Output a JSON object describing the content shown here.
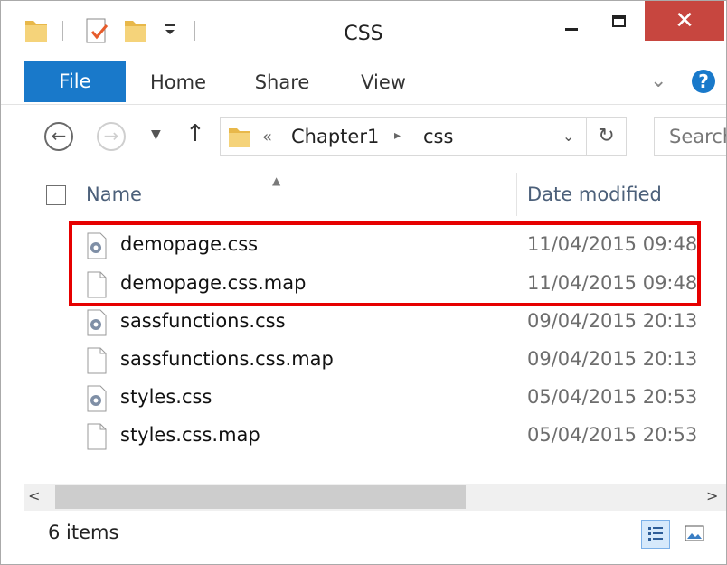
{
  "window": {
    "title": "CSS",
    "close_glyph": "✕"
  },
  "quick_access": {
    "icons": [
      "folder-icon",
      "properties-icon",
      "new-folder-icon",
      "customize-dropdown-icon"
    ]
  },
  "ribbon": {
    "tabs": [
      {
        "label": "File",
        "active": true
      },
      {
        "label": "Home"
      },
      {
        "label": "Share"
      },
      {
        "label": "View"
      }
    ],
    "expand_glyph": "⌄",
    "help_glyph": "?"
  },
  "nav": {
    "back_glyph": "←",
    "forward_glyph": "→",
    "recent_glyph": "▼",
    "up_glyph": "↑",
    "breadcrumb_prefix": "«",
    "breadcrumb": [
      "Chapter1",
      "css"
    ],
    "breadcrumb_sep": "▸",
    "address_dropdown_glyph": "⌄",
    "refresh_glyph": "↻",
    "search_placeholder": "Search"
  },
  "list": {
    "sort_glyph": "▲",
    "columns": {
      "name": "Name",
      "date": "Date modified"
    },
    "files": [
      {
        "name": "demopage.css",
        "date": "11/04/2015 09:48",
        "icon": "css-file-icon"
      },
      {
        "name": "demopage.css.map",
        "date": "11/04/2015 09:48",
        "icon": "blank-file-icon"
      },
      {
        "name": "sassfunctions.css",
        "date": "09/04/2015 20:13",
        "icon": "css-file-icon"
      },
      {
        "name": "sassfunctions.css.map",
        "date": "09/04/2015 20:13",
        "icon": "blank-file-icon"
      },
      {
        "name": "styles.css",
        "date": "05/04/2015 20:53",
        "icon": "css-file-icon"
      },
      {
        "name": "styles.css.map",
        "date": "05/04/2015 20:53",
        "icon": "blank-file-icon"
      }
    ],
    "highlighted_files": [
      "demopage.css",
      "demopage.css.map"
    ]
  },
  "scrollbar": {
    "left_glyph": "<",
    "right_glyph": ">"
  },
  "status": {
    "item_count": "6 items"
  },
  "colors": {
    "accent": "#1979ca",
    "close": "#c7463f",
    "highlight": "#e60000"
  }
}
